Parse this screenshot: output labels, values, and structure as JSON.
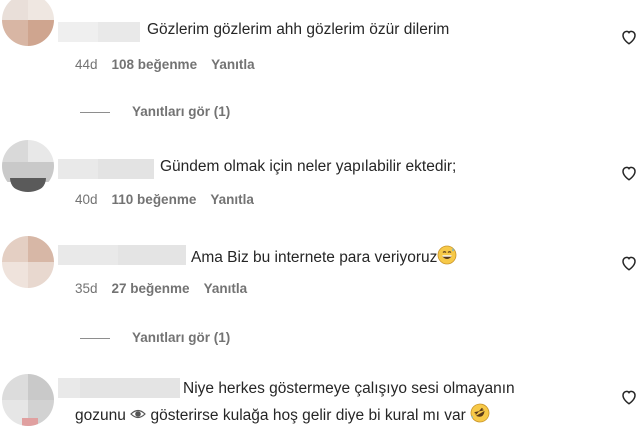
{
  "comments": [
    {
      "text": "Gözlerim gözlerim ahh gözlerim özür dilerim",
      "age": "44d",
      "likes": "108 beğenme",
      "reply": "Yanıtla",
      "view_replies": "Yanıtları gör (1)"
    },
    {
      "text": "Gündem olmak için neler yapılabilir ektedir;",
      "age": "40d",
      "likes": "110 beğenme",
      "reply": "Yanıtla"
    },
    {
      "text": "Ama Biz bu internete para veriyoruz",
      "emoji": "grinning-sweat-emoji",
      "age": "35d",
      "likes": "27 beğenme",
      "reply": "Yanıtla",
      "view_replies": "Yanıtları gör (1)"
    },
    {
      "line1": "Niye herkes göstermeye çalışıyo sesi olmayanın",
      "line2_pre": "gozunu",
      "line2_post": "gösterirse kulağa hoş gelir diye bi kural mı var",
      "emoji_eye": "eye-emoji",
      "emoji_end": "rolling-laughing-emoji"
    }
  ],
  "icons": {
    "like": "heart-outline-icon"
  },
  "colors": {
    "text": "#262626",
    "meta": "#737373",
    "blur": "#e9e9e9"
  }
}
